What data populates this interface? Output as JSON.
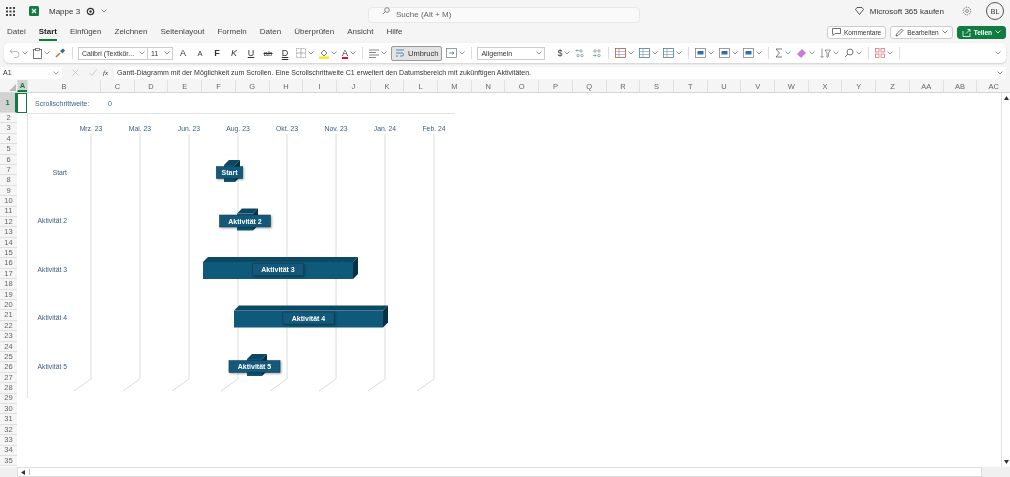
{
  "title_bar": {
    "file_name": "Mappe 3",
    "search": {
      "placeholder": "Suche (Alt + M)"
    },
    "buy_label": "Microsoft 365 kaufen",
    "avatar": "BL"
  },
  "tabs": [
    {
      "label": "Datei",
      "selected": false
    },
    {
      "label": "Start",
      "selected": true
    },
    {
      "label": "Einfügen",
      "selected": false
    },
    {
      "label": "Zeichnen",
      "selected": false
    },
    {
      "label": "Seitenlayout",
      "selected": false
    },
    {
      "label": "Formeln",
      "selected": false
    },
    {
      "label": "Daten",
      "selected": false
    },
    {
      "label": "Überprüfen",
      "selected": false
    },
    {
      "label": "Ansicht",
      "selected": false
    },
    {
      "label": "Hilfe",
      "selected": false
    }
  ],
  "actions": {
    "comments": "Kommentare",
    "edit": "Bearbeiten",
    "share": "Teilen"
  },
  "ribbon": {
    "font": "Calibri (Textkör...",
    "font_size": "11",
    "format_glyphs": [
      {
        "text": "A",
        "kind": "grow"
      },
      {
        "text": "A",
        "kind": "shrink"
      },
      {
        "text": "F",
        "kind": "bold"
      },
      {
        "text": "K",
        "kind": "italic"
      },
      {
        "text": "U",
        "kind": "underline"
      },
      {
        "text": "ab",
        "kind": "strike"
      },
      {
        "text": "D",
        "kind": "double"
      }
    ],
    "font_color": "A",
    "wrap": {
      "label": "Umbruch",
      "selected": true
    },
    "number_format": "Allgemein",
    "currency": "$"
  },
  "formula_bar": {
    "name_box": "A1",
    "fx": "fx",
    "formula": "Gantt-Diagramm mit der Möglichkeit zum Scrollen. Eine Scrollschrittweite C1 erweitert den Datumsbereich mit zukünftigen Aktivitäten."
  },
  "columns": [
    {
      "label": "A",
      "selected": true
    },
    {
      "label": "B",
      "selected": false
    },
    {
      "label": "C",
      "selected": false
    },
    {
      "label": "D",
      "selected": false
    },
    {
      "label": "E",
      "selected": false
    },
    {
      "label": "F",
      "selected": false
    },
    {
      "label": "G",
      "selected": false
    },
    {
      "label": "H",
      "selected": false
    },
    {
      "label": "I",
      "selected": false
    },
    {
      "label": "J",
      "selected": false
    },
    {
      "label": "K",
      "selected": false
    },
    {
      "label": "L",
      "selected": false
    },
    {
      "label": "M",
      "selected": false
    },
    {
      "label": "N",
      "selected": false
    },
    {
      "label": "O",
      "selected": false
    },
    {
      "label": "P",
      "selected": false
    },
    {
      "label": "Q",
      "selected": false
    },
    {
      "label": "R",
      "selected": false
    },
    {
      "label": "S",
      "selected": false
    },
    {
      "label": "T",
      "selected": false
    },
    {
      "label": "U",
      "selected": false
    },
    {
      "label": "V",
      "selected": false
    },
    {
      "label": "W",
      "selected": false
    },
    {
      "label": "X",
      "selected": false
    },
    {
      "label": "Y",
      "selected": false
    },
    {
      "label": "Z",
      "selected": false
    },
    {
      "label": "AA",
      "selected": false
    },
    {
      "label": "AB",
      "selected": false
    },
    {
      "label": "AC",
      "selected": false
    }
  ],
  "rows": [
    {
      "label": "1",
      "selected": true
    },
    {
      "label": "2",
      "selected": false
    },
    {
      "label": "3",
      "selected": false
    },
    {
      "label": "4",
      "selected": false
    },
    {
      "label": "5",
      "selected": false
    },
    {
      "label": "6",
      "selected": false
    },
    {
      "label": "7",
      "selected": false
    },
    {
      "label": "8",
      "selected": false
    },
    {
      "label": "9",
      "selected": false
    },
    {
      "label": "10",
      "selected": false
    },
    {
      "label": "11",
      "selected": false
    },
    {
      "label": "12",
      "selected": false
    },
    {
      "label": "13",
      "selected": false
    },
    {
      "label": "14",
      "selected": false
    },
    {
      "label": "15",
      "selected": false
    },
    {
      "label": "16",
      "selected": false
    },
    {
      "label": "17",
      "selected": false
    },
    {
      "label": "18",
      "selected": false
    },
    {
      "label": "19",
      "selected": false
    },
    {
      "label": "20",
      "selected": false
    },
    {
      "label": "21",
      "selected": false
    },
    {
      "label": "22",
      "selected": false
    },
    {
      "label": "23",
      "selected": false
    },
    {
      "label": "24",
      "selected": false
    },
    {
      "label": "25",
      "selected": false
    },
    {
      "label": "26",
      "selected": false
    },
    {
      "label": "27",
      "selected": false
    },
    {
      "label": "28",
      "selected": false
    },
    {
      "label": "29",
      "selected": false
    },
    {
      "label": "30",
      "selected": false
    },
    {
      "label": "31",
      "selected": false
    },
    {
      "label": "32",
      "selected": false
    },
    {
      "label": "33",
      "selected": false
    },
    {
      "label": "34",
      "selected": false
    },
    {
      "label": "35",
      "selected": false
    }
  ],
  "scroll_step": {
    "label": "Scrollschrittweite:",
    "value": "0"
  },
  "chart": {
    "date_labels": [
      "Mrz. 23",
      "Mai. 23",
      "Jun. 23",
      "Aug. 23",
      "Okt. 23",
      "Nov. 23",
      "Jan. 24",
      "Feb. 24"
    ],
    "activity_labels": [
      "Start",
      "Aktivität 2",
      "Aktivität 3",
      "Aktivität 4",
      "Aktivität 5"
    ],
    "bar_labels": [
      "Start",
      "Aktivität 2",
      "Aktivität 3",
      "Aktivität 4",
      "Aktivität 5"
    ]
  }
}
